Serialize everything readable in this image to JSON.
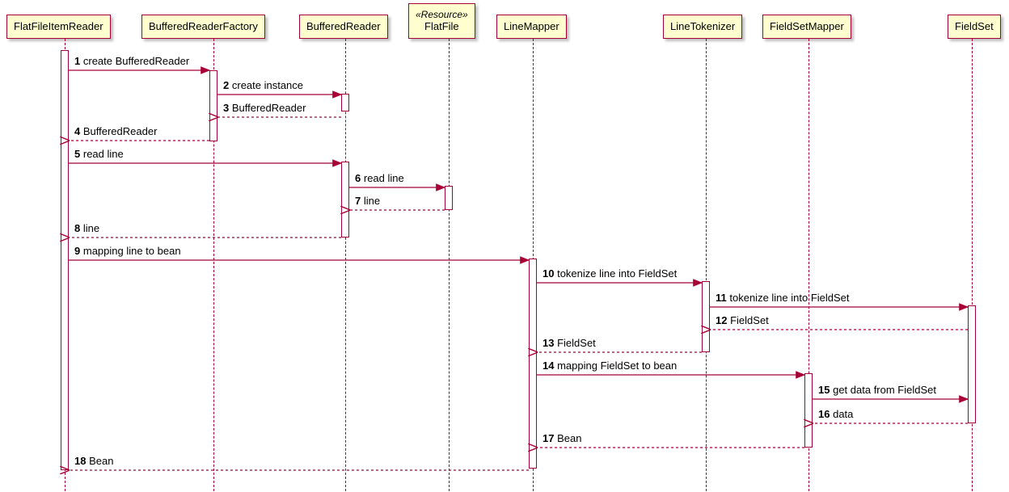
{
  "participants": {
    "ffir": "FlatFileItemReader",
    "brf": "BufferedReaderFactory",
    "br": "BufferedReader",
    "flatfile_stereo": "«Resource»",
    "flatfile": "FlatFile",
    "lm": "LineMapper",
    "lt": "LineTokenizer",
    "fsm": "FieldSetMapper",
    "fs": "FieldSet"
  },
  "messages": {
    "m1": {
      "n": "1",
      "t": "create BufferedReader"
    },
    "m2": {
      "n": "2",
      "t": "create instance"
    },
    "m3": {
      "n": "3",
      "t": "BufferedReader"
    },
    "m4": {
      "n": "4",
      "t": "BufferedReader"
    },
    "m5": {
      "n": "5",
      "t": "read line"
    },
    "m6": {
      "n": "6",
      "t": "read line"
    },
    "m7": {
      "n": "7",
      "t": "line"
    },
    "m8": {
      "n": "8",
      "t": "line"
    },
    "m9": {
      "n": "9",
      "t": "mapping line to bean"
    },
    "m10": {
      "n": "10",
      "t": "tokenize line into FieldSet"
    },
    "m11": {
      "n": "11",
      "t": "tokenize line into FieldSet"
    },
    "m12": {
      "n": "12",
      "t": "FieldSet"
    },
    "m13": {
      "n": "13",
      "t": "FieldSet"
    },
    "m14": {
      "n": "14",
      "t": "mapping FieldSet to bean"
    },
    "m15": {
      "n": "15",
      "t": "get data from FieldSet"
    },
    "m16": {
      "n": "16",
      "t": "data"
    },
    "m17": {
      "n": "17",
      "t": "Bean"
    },
    "m18": {
      "n": "18",
      "t": "Bean"
    }
  },
  "chart_data": {
    "type": "sequence-diagram",
    "participants": [
      "FlatFileItemReader",
      "BufferedReaderFactory",
      "BufferedReader",
      "«Resource» FlatFile",
      "LineMapper",
      "LineTokenizer",
      "FieldSetMapper",
      "FieldSet"
    ],
    "messages": [
      {
        "n": 1,
        "from": "FlatFileItemReader",
        "to": "BufferedReaderFactory",
        "label": "create BufferedReader",
        "kind": "call"
      },
      {
        "n": 2,
        "from": "BufferedReaderFactory",
        "to": "BufferedReader",
        "label": "create instance",
        "kind": "call"
      },
      {
        "n": 3,
        "from": "BufferedReader",
        "to": "BufferedReaderFactory",
        "label": "BufferedReader",
        "kind": "return"
      },
      {
        "n": 4,
        "from": "BufferedReaderFactory",
        "to": "FlatFileItemReader",
        "label": "BufferedReader",
        "kind": "return"
      },
      {
        "n": 5,
        "from": "FlatFileItemReader",
        "to": "BufferedReader",
        "label": "read line",
        "kind": "call"
      },
      {
        "n": 6,
        "from": "BufferedReader",
        "to": "FlatFile",
        "label": "read line",
        "kind": "call"
      },
      {
        "n": 7,
        "from": "FlatFile",
        "to": "BufferedReader",
        "label": "line",
        "kind": "return"
      },
      {
        "n": 8,
        "from": "BufferedReader",
        "to": "FlatFileItemReader",
        "label": "line",
        "kind": "return"
      },
      {
        "n": 9,
        "from": "FlatFileItemReader",
        "to": "LineMapper",
        "label": "mapping line to bean",
        "kind": "call"
      },
      {
        "n": 10,
        "from": "LineMapper",
        "to": "LineTokenizer",
        "label": "tokenize line into FieldSet",
        "kind": "call"
      },
      {
        "n": 11,
        "from": "LineTokenizer",
        "to": "FieldSet",
        "label": "tokenize line into FieldSet",
        "kind": "call"
      },
      {
        "n": 12,
        "from": "FieldSet",
        "to": "LineTokenizer",
        "label": "FieldSet",
        "kind": "return"
      },
      {
        "n": 13,
        "from": "LineTokenizer",
        "to": "LineMapper",
        "label": "FieldSet",
        "kind": "return"
      },
      {
        "n": 14,
        "from": "LineMapper",
        "to": "FieldSetMapper",
        "label": "mapping FieldSet to bean",
        "kind": "call"
      },
      {
        "n": 15,
        "from": "FieldSetMapper",
        "to": "FieldSet",
        "label": "get data from FieldSet",
        "kind": "call"
      },
      {
        "n": 16,
        "from": "FieldSet",
        "to": "FieldSetMapper",
        "label": "data",
        "kind": "return"
      },
      {
        "n": 17,
        "from": "FieldSetMapper",
        "to": "LineMapper",
        "label": "Bean",
        "kind": "return"
      },
      {
        "n": 18,
        "from": "LineMapper",
        "to": "FlatFileItemReader",
        "label": "Bean",
        "kind": "return"
      }
    ]
  }
}
